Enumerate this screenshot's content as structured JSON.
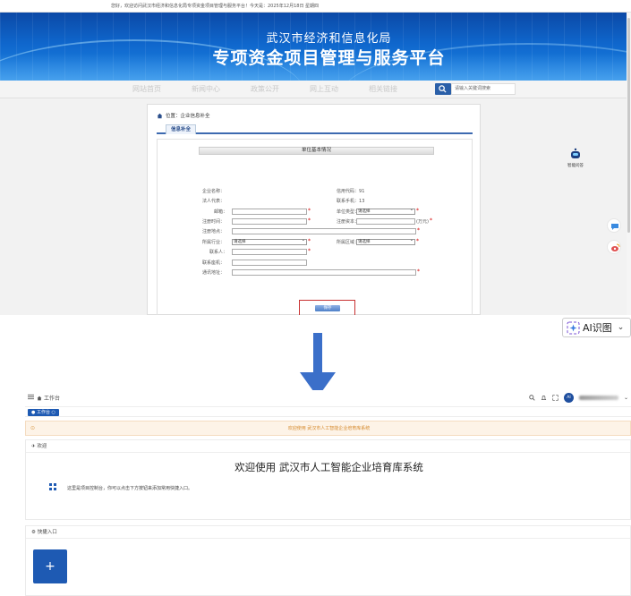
{
  "top": {
    "topbar_text": "您好，欢迎访问武汉市经济和信息化局专项资金项目管理与服务平台！今天是：2025年12月18日 星期四",
    "banner_title_1": "武汉市经济和信息化局",
    "banner_title_2": "专项资金项目管理与服务平台",
    "nav_items": [
      "网站首页",
      "新闻中心",
      "政策公开",
      "网上互动",
      "相关链接"
    ],
    "search_placeholder": "请输入关键词搜索",
    "breadcrumb": "位置：企业信息补全",
    "tab_label": "信息补全",
    "section_title": "单位基本情况",
    "fields": {
      "company_name": "企业名称",
      "credit_code": "信用代码",
      "legal_rep": "法人代表",
      "contact_phone": "联系手机",
      "email": "邮箱",
      "unit_type": "单位类型",
      "reg_time": "注册时间",
      "reg_capital": "注册资本",
      "capital_unit": "(万元)",
      "reg_address": "注册地点",
      "industry": "所属行业",
      "region": "所属区域",
      "contact_person": "联系人",
      "contact_tel": "联系座机",
      "mail_address": "通讯地址"
    },
    "credit_code_value": "91",
    "contact_phone_value": "13",
    "select_placeholder": "请选择",
    "save_label": "保存",
    "robot_label": "智能问答"
  },
  "ai_badge": "AI识图",
  "bottom": {
    "header_title": "工作台",
    "tag_label": "工作台",
    "notice": "欢迎使用 武汉市人工智能企业培育库系统",
    "welcome_section_title": "欢迎",
    "welcome_title": "欢迎使用 武汉市人工智能企业培育库系统",
    "welcome_text": "这里是项目控制台，你可以点击下方按钮来添加常用快捷入口。",
    "quick_section_title": "快捷入口",
    "plus_label": "+",
    "avatar_text": "AI"
  },
  "colors": {
    "banner_blue": "#0f66cc",
    "primary_blue": "#1e5ab3",
    "notice_bg": "#fdf3e7",
    "required_red": "#d40000",
    "arrow_blue": "#3b6fc9"
  }
}
